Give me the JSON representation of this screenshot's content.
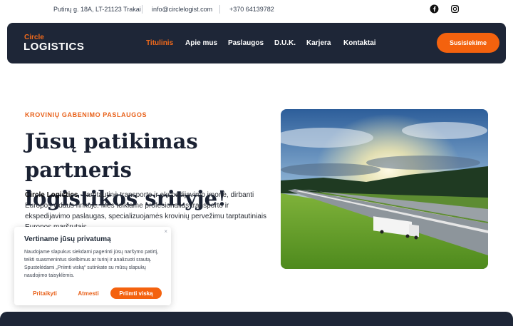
{
  "topbar": {
    "address": "Putinų g. 18A, LT-21123 Trakai",
    "email": "info@circlelogist.com",
    "phone": "+370 64139782",
    "social_icons": [
      "facebook-icon",
      "instagram-icon"
    ]
  },
  "brand": {
    "line1": "Circle",
    "line2": "LOGISTICS",
    "accent": "#f26a1b",
    "dark": "#1e2637"
  },
  "nav": {
    "items": [
      "Titulinis",
      "Apie mus",
      "Paslaugos",
      "D.U.K.",
      "Karjera",
      "Kontaktai"
    ],
    "active": "Titulinis",
    "cta": "Susisiekime"
  },
  "hero": {
    "eyebrow": "KROVINIŲ GABENIMO PASLAUGOS",
    "title_line1": "Jūsų patikimas partneris",
    "title_line2": "logistikos srityje!",
    "company": "Circle Logistics",
    "description": " - tarptautinė transporto ir ekspedijavimo įmonė, dirbanti Europos vidaus rinkoje. Mes teikiame profesionalias transporto ir ekspedijavimo paslaugas, specializuojamės krovinių pervežimu tarptautiniais Europos maršrutais."
  },
  "cookie": {
    "title": "Vertiname jūsų privatumą",
    "text": "Naudojame slapukus siekdami pagerinti jūsų naršymo patirtį, teikti suasmenintus skelbimus ar turinį ir analizuoti srautą. Spustelėdami „Priimti viską“ sutinkate su mūsų slapukų naudojimo taisyklėmis.",
    "customize": "Pritaikyti",
    "reject": "Atmesti",
    "accept": "Priimti viską",
    "close": "×"
  }
}
